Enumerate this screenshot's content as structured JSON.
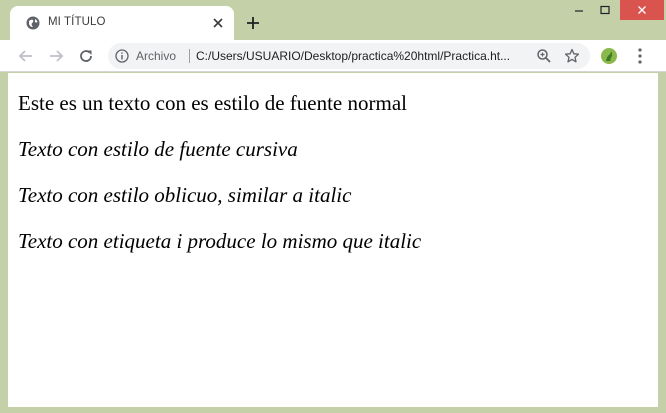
{
  "browser": {
    "tab": {
      "title": "MI TÍTULO",
      "favicon": "globe-icon",
      "close": "close-icon"
    },
    "new_tab": "plus-icon",
    "window_controls": [
      "minimize-icon",
      "maximize-icon",
      "close-icon"
    ],
    "toolbar": {
      "back": "arrow-left-icon",
      "forward": "arrow-right-icon",
      "reload": "reload-icon",
      "scheme_label": "Archivo",
      "url": "C:/Users/USUARIO/Desktop/practica%20html/Practica.ht...",
      "zoom": "zoom-icon",
      "bookmark": "star-icon",
      "extension": "extension-icon",
      "menu": "kebab-menu-icon"
    },
    "colors": {
      "frame": "#c4d1a8",
      "close_button": "#d9534f",
      "omnibox": "#f1f3f4"
    }
  },
  "page": {
    "lines": [
      "Este es un texto con es estilo de fuente normal",
      "Texto con estilo de fuente cursiva",
      "Texto con estilo oblicuo, similar a italic",
      "Texto con etiqueta i produce lo mismo que italic"
    ]
  }
}
